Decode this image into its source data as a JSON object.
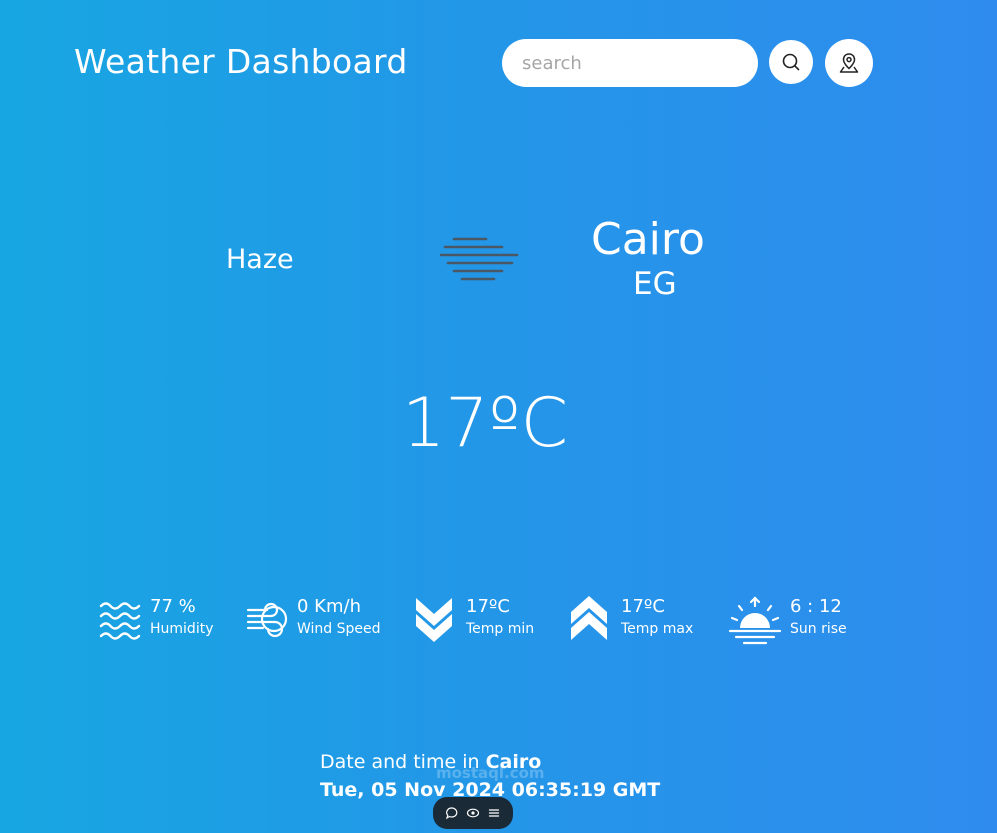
{
  "header": {
    "title": "Weather Dashboard",
    "search_placeholder": "search"
  },
  "current": {
    "condition": "Haze",
    "city": "Cairo",
    "country": "EG",
    "temperature": "17ºC"
  },
  "stats": [
    {
      "value": "77 %",
      "label": "Humidity",
      "icon": "humidity-icon"
    },
    {
      "value": "0 Km/h",
      "label": "Wind Speed",
      "icon": "wind-icon"
    },
    {
      "value": "17ºC",
      "label": "Temp min",
      "icon": "temp-min-icon"
    },
    {
      "value": "17ºC",
      "label": "Temp max",
      "icon": "temp-max-icon"
    },
    {
      "value": "6 : 12",
      "label": "Sun rise",
      "icon": "sunrise-icon"
    }
  ],
  "footer": {
    "prefix": "Date and time in ",
    "city": "Cairo",
    "datetime": "Tue, 05 Nov 2024 06:35:19 GMT"
  },
  "watermark": "mostaql.com",
  "colors": {
    "background_start": "#18a6e2",
    "background_end": "#2f8cee",
    "text": "#ffffff"
  }
}
